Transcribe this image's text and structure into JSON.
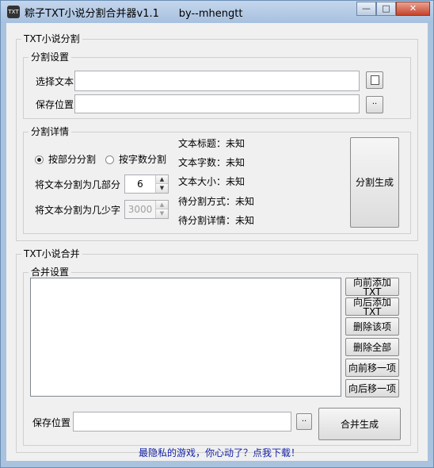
{
  "window": {
    "title": "粽子TXT小说分割合并器v1.1",
    "author": "by--mhengtt",
    "icon_text": "TXT",
    "controls": {
      "minimize": "—",
      "maximize": "□",
      "close": "✕"
    }
  },
  "split": {
    "group_title": "TXT小说分割",
    "settings": {
      "title": "分割设置",
      "select_text_label": "选择文本",
      "select_text_value": "",
      "browse_icon": "file-icon",
      "save_label": "保存位置",
      "save_value": "",
      "save_browse_label": "··"
    },
    "details": {
      "title": "分割详情",
      "radio_by_part": "按部分分割",
      "radio_by_chars": "按字数分割",
      "selected_mode": "按部分分割",
      "parts_label": "将文本分割为几部分",
      "parts_value": "6",
      "chars_label": "将文本分割为几少字",
      "chars_value": "3000",
      "info": [
        {
          "label": "文本标题：",
          "value": "未知"
        },
        {
          "label": "文本字数：",
          "value": "未知"
        },
        {
          "label": "文本大小：",
          "value": "未知"
        },
        {
          "label": "待分割方式：",
          "value": "未知"
        },
        {
          "label": "待分割详情：",
          "value": "未知"
        }
      ]
    },
    "generate_button": "分割生成"
  },
  "merge": {
    "group_title": "TXT小说合并",
    "settings_title": "合并设置",
    "buttons": {
      "add_front": [
        "向前添加",
        "TXT"
      ],
      "add_back": [
        "向后添加",
        "TXT"
      ],
      "delete_item": "删除该项",
      "delete_all": "删除全部",
      "move_up": "向前移一项",
      "move_down": "向后移一项"
    },
    "save_label": "保存位置",
    "save_value": "",
    "save_browse_label": "··",
    "generate_button": "合并生成"
  },
  "footer": {
    "promo_link": "最隐私的游戏，你心动了？点我下载！"
  },
  "colors": {
    "link": "#1523a8",
    "title_bar": "#a9c2de",
    "client_bg": "#f0f0f0"
  }
}
